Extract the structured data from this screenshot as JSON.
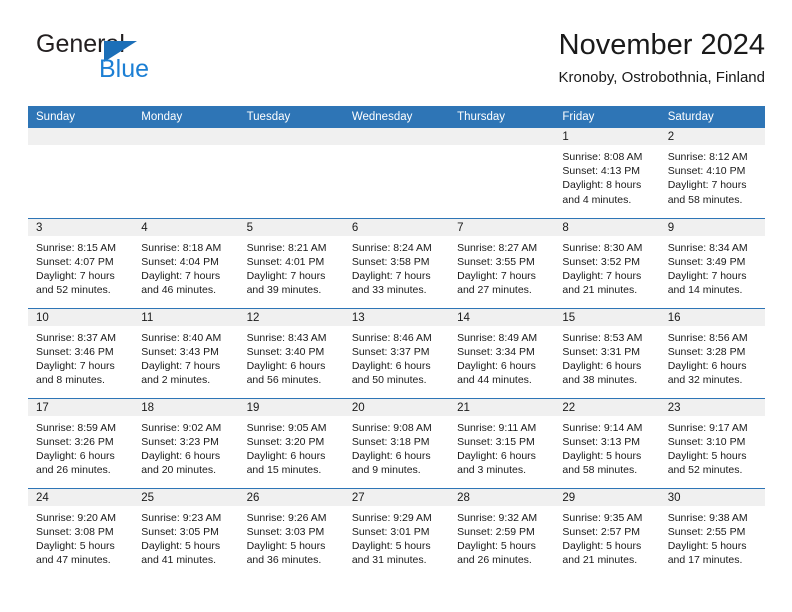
{
  "brand": {
    "name_part1": "General",
    "name_part2": "Blue",
    "triangle_color": "#1c6fb8",
    "blue_color": "#1c7fd4"
  },
  "header": {
    "title": "November 2024",
    "subtitle": "Kronoby, Ostrobothnia, Finland",
    "accent_color": "#2e75b6"
  },
  "calendar": {
    "weekday_headers": [
      "Sunday",
      "Monday",
      "Tuesday",
      "Wednesday",
      "Thursday",
      "Friday",
      "Saturday"
    ],
    "weeks": [
      [
        {
          "day": "",
          "empty": true
        },
        {
          "day": "",
          "empty": true
        },
        {
          "day": "",
          "empty": true
        },
        {
          "day": "",
          "empty": true
        },
        {
          "day": "",
          "empty": true
        },
        {
          "day": "1",
          "sunrise": "Sunrise: 8:08 AM",
          "sunset": "Sunset: 4:13 PM",
          "daylight_line1": "Daylight: 8 hours",
          "daylight_line2": "and 4 minutes."
        },
        {
          "day": "2",
          "sunrise": "Sunrise: 8:12 AM",
          "sunset": "Sunset: 4:10 PM",
          "daylight_line1": "Daylight: 7 hours",
          "daylight_line2": "and 58 minutes."
        }
      ],
      [
        {
          "day": "3",
          "sunrise": "Sunrise: 8:15 AM",
          "sunset": "Sunset: 4:07 PM",
          "daylight_line1": "Daylight: 7 hours",
          "daylight_line2": "and 52 minutes."
        },
        {
          "day": "4",
          "sunrise": "Sunrise: 8:18 AM",
          "sunset": "Sunset: 4:04 PM",
          "daylight_line1": "Daylight: 7 hours",
          "daylight_line2": "and 46 minutes."
        },
        {
          "day": "5",
          "sunrise": "Sunrise: 8:21 AM",
          "sunset": "Sunset: 4:01 PM",
          "daylight_line1": "Daylight: 7 hours",
          "daylight_line2": "and 39 minutes."
        },
        {
          "day": "6",
          "sunrise": "Sunrise: 8:24 AM",
          "sunset": "Sunset: 3:58 PM",
          "daylight_line1": "Daylight: 7 hours",
          "daylight_line2": "and 33 minutes."
        },
        {
          "day": "7",
          "sunrise": "Sunrise: 8:27 AM",
          "sunset": "Sunset: 3:55 PM",
          "daylight_line1": "Daylight: 7 hours",
          "daylight_line2": "and 27 minutes."
        },
        {
          "day": "8",
          "sunrise": "Sunrise: 8:30 AM",
          "sunset": "Sunset: 3:52 PM",
          "daylight_line1": "Daylight: 7 hours",
          "daylight_line2": "and 21 minutes."
        },
        {
          "day": "9",
          "sunrise": "Sunrise: 8:34 AM",
          "sunset": "Sunset: 3:49 PM",
          "daylight_line1": "Daylight: 7 hours",
          "daylight_line2": "and 14 minutes."
        }
      ],
      [
        {
          "day": "10",
          "sunrise": "Sunrise: 8:37 AM",
          "sunset": "Sunset: 3:46 PM",
          "daylight_line1": "Daylight: 7 hours",
          "daylight_line2": "and 8 minutes."
        },
        {
          "day": "11",
          "sunrise": "Sunrise: 8:40 AM",
          "sunset": "Sunset: 3:43 PM",
          "daylight_line1": "Daylight: 7 hours",
          "daylight_line2": "and 2 minutes."
        },
        {
          "day": "12",
          "sunrise": "Sunrise: 8:43 AM",
          "sunset": "Sunset: 3:40 PM",
          "daylight_line1": "Daylight: 6 hours",
          "daylight_line2": "and 56 minutes."
        },
        {
          "day": "13",
          "sunrise": "Sunrise: 8:46 AM",
          "sunset": "Sunset: 3:37 PM",
          "daylight_line1": "Daylight: 6 hours",
          "daylight_line2": "and 50 minutes."
        },
        {
          "day": "14",
          "sunrise": "Sunrise: 8:49 AM",
          "sunset": "Sunset: 3:34 PM",
          "daylight_line1": "Daylight: 6 hours",
          "daylight_line2": "and 44 minutes."
        },
        {
          "day": "15",
          "sunrise": "Sunrise: 8:53 AM",
          "sunset": "Sunset: 3:31 PM",
          "daylight_line1": "Daylight: 6 hours",
          "daylight_line2": "and 38 minutes."
        },
        {
          "day": "16",
          "sunrise": "Sunrise: 8:56 AM",
          "sunset": "Sunset: 3:28 PM",
          "daylight_line1": "Daylight: 6 hours",
          "daylight_line2": "and 32 minutes."
        }
      ],
      [
        {
          "day": "17",
          "sunrise": "Sunrise: 8:59 AM",
          "sunset": "Sunset: 3:26 PM",
          "daylight_line1": "Daylight: 6 hours",
          "daylight_line2": "and 26 minutes."
        },
        {
          "day": "18",
          "sunrise": "Sunrise: 9:02 AM",
          "sunset": "Sunset: 3:23 PM",
          "daylight_line1": "Daylight: 6 hours",
          "daylight_line2": "and 20 minutes."
        },
        {
          "day": "19",
          "sunrise": "Sunrise: 9:05 AM",
          "sunset": "Sunset: 3:20 PM",
          "daylight_line1": "Daylight: 6 hours",
          "daylight_line2": "and 15 minutes."
        },
        {
          "day": "20",
          "sunrise": "Sunrise: 9:08 AM",
          "sunset": "Sunset: 3:18 PM",
          "daylight_line1": "Daylight: 6 hours",
          "daylight_line2": "and 9 minutes."
        },
        {
          "day": "21",
          "sunrise": "Sunrise: 9:11 AM",
          "sunset": "Sunset: 3:15 PM",
          "daylight_line1": "Daylight: 6 hours",
          "daylight_line2": "and 3 minutes."
        },
        {
          "day": "22",
          "sunrise": "Sunrise: 9:14 AM",
          "sunset": "Sunset: 3:13 PM",
          "daylight_line1": "Daylight: 5 hours",
          "daylight_line2": "and 58 minutes."
        },
        {
          "day": "23",
          "sunrise": "Sunrise: 9:17 AM",
          "sunset": "Sunset: 3:10 PM",
          "daylight_line1": "Daylight: 5 hours",
          "daylight_line2": "and 52 minutes."
        }
      ],
      [
        {
          "day": "24",
          "sunrise": "Sunrise: 9:20 AM",
          "sunset": "Sunset: 3:08 PM",
          "daylight_line1": "Daylight: 5 hours",
          "daylight_line2": "and 47 minutes."
        },
        {
          "day": "25",
          "sunrise": "Sunrise: 9:23 AM",
          "sunset": "Sunset: 3:05 PM",
          "daylight_line1": "Daylight: 5 hours",
          "daylight_line2": "and 41 minutes."
        },
        {
          "day": "26",
          "sunrise": "Sunrise: 9:26 AM",
          "sunset": "Sunset: 3:03 PM",
          "daylight_line1": "Daylight: 5 hours",
          "daylight_line2": "and 36 minutes."
        },
        {
          "day": "27",
          "sunrise": "Sunrise: 9:29 AM",
          "sunset": "Sunset: 3:01 PM",
          "daylight_line1": "Daylight: 5 hours",
          "daylight_line2": "and 31 minutes."
        },
        {
          "day": "28",
          "sunrise": "Sunrise: 9:32 AM",
          "sunset": "Sunset: 2:59 PM",
          "daylight_line1": "Daylight: 5 hours",
          "daylight_line2": "and 26 minutes."
        },
        {
          "day": "29",
          "sunrise": "Sunrise: 9:35 AM",
          "sunset": "Sunset: 2:57 PM",
          "daylight_line1": "Daylight: 5 hours",
          "daylight_line2": "and 21 minutes."
        },
        {
          "day": "30",
          "sunrise": "Sunrise: 9:38 AM",
          "sunset": "Sunset: 2:55 PM",
          "daylight_line1": "Daylight: 5 hours",
          "daylight_line2": "and 17 minutes."
        }
      ]
    ]
  }
}
